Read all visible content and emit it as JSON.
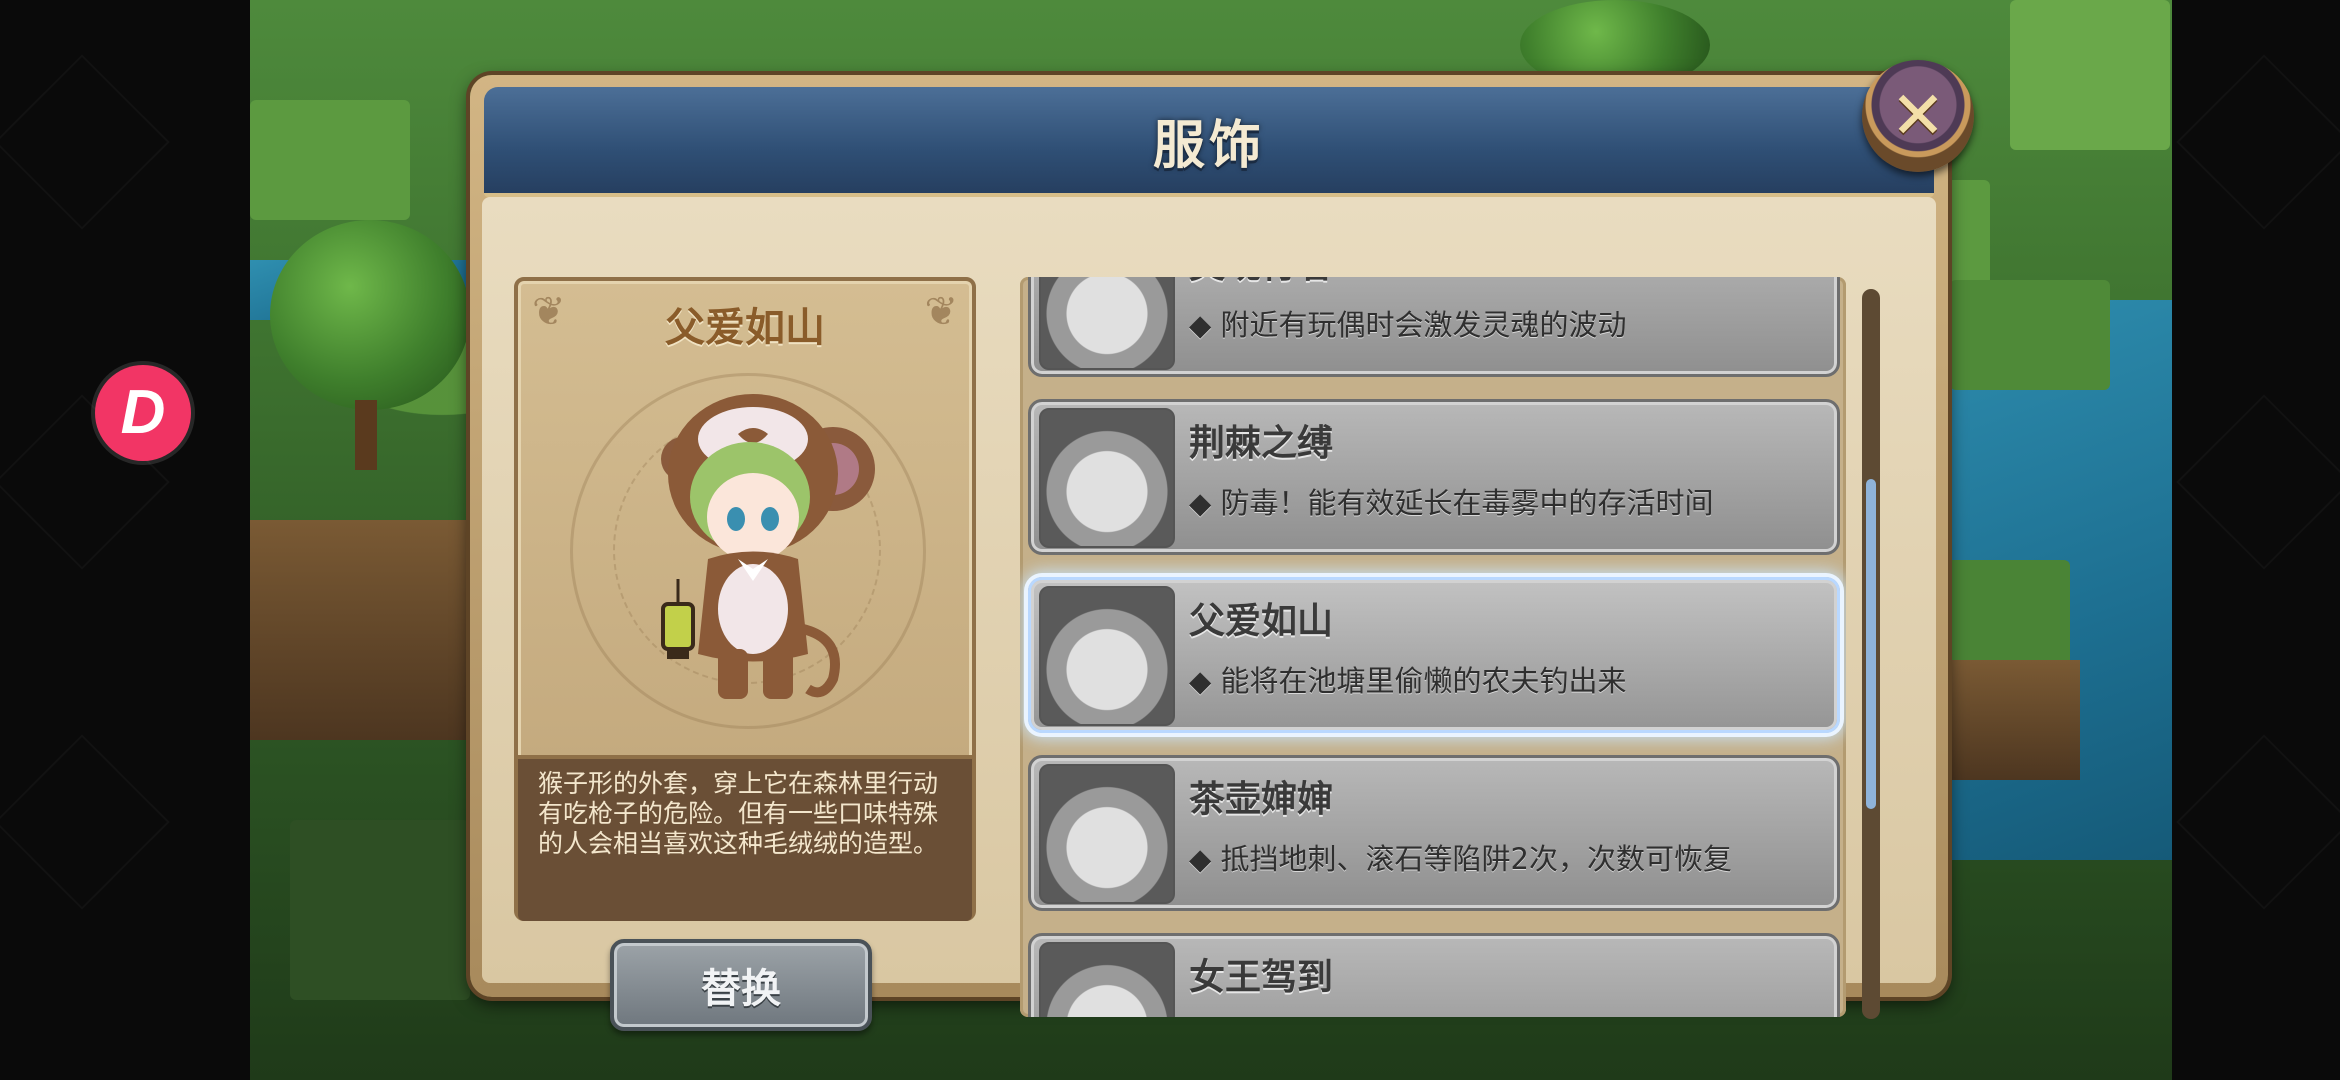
{
  "dialog": {
    "title": "服饰",
    "close_icon": "close-icon"
  },
  "selected_costume": {
    "name": "父爱如山",
    "description": "猴子形的外套，穿上它在森林里行动有吃枪子的危险。但有一些口味特殊的人会相当喜欢这种毛绒绒的造型。"
  },
  "replace_button": {
    "label": "替换"
  },
  "costume_list": [
    {
      "name": "灵魂行者",
      "effect": "◆ 附近有玩偶时会激发灵魂的波动",
      "selected": false
    },
    {
      "name": "荆棘之缚",
      "effect": "◆ 防毒！能有效延长在毒雾中的存活时间",
      "selected": false
    },
    {
      "name": "父爱如山",
      "effect": "◆ 能将在池塘里偷懒的农夫钓出来",
      "selected": true
    },
    {
      "name": "茶壶婶婶",
      "effect": "◆ 抵挡地刺、滚石等陷阱2次，次数可恢复",
      "selected": false
    },
    {
      "name": "女王驾到",
      "effect": "",
      "selected": false
    }
  ],
  "overlay_app": {
    "icon": "app-logo-icon",
    "color": "#f23565"
  },
  "colors": {
    "title_bar": "#2f4f75",
    "panel": "#d2b584",
    "selected_glow": "#eaf4ff",
    "scrollbar_thumb": "#8fb3d9"
  }
}
